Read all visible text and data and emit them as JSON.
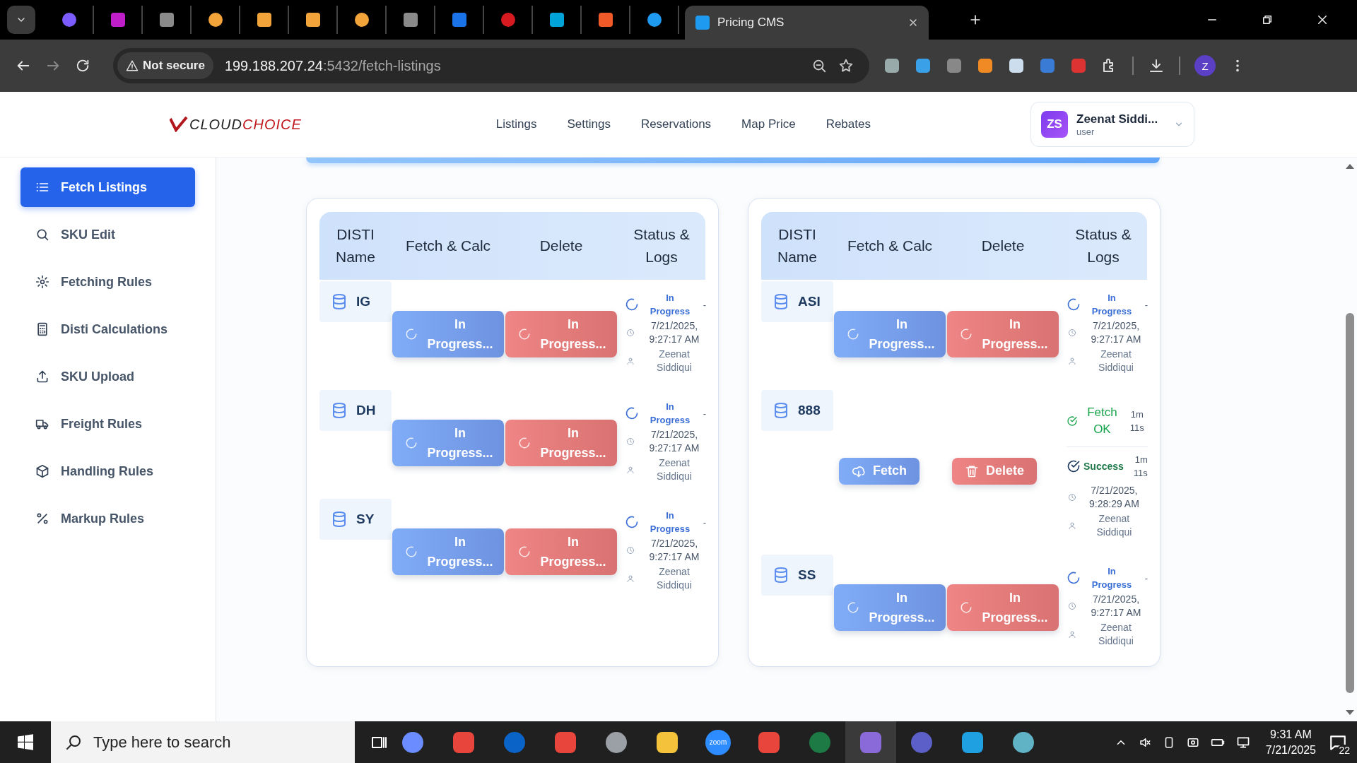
{
  "browser": {
    "tabs": [
      {
        "color": "#7c5cff",
        "selected": false
      },
      {
        "color": "#c01ec8",
        "selected": false
      },
      {
        "color": "#8a8a8a",
        "selected": false
      },
      {
        "color": "#f2a33a",
        "selected": false
      },
      {
        "color": "#f2a33a",
        "selected": false
      },
      {
        "color": "#f2a33a",
        "selected": false
      },
      {
        "color": "#f2a33a",
        "selected": false
      },
      {
        "color": "#8a8a8a",
        "selected": false
      },
      {
        "color": "#1a73e8",
        "selected": false
      },
      {
        "color": "#d71920",
        "selected": false
      },
      {
        "color": "#00a3d9",
        "selected": false
      },
      {
        "color": "#f05a28",
        "selected": false
      },
      {
        "color": "#1e9bf0",
        "selected": false
      },
      {
        "color": "#1e9bf0",
        "title": "Pricing CMS",
        "selected": true
      }
    ],
    "security": "Not secure",
    "url_host": "199.188.207.24",
    "url_path": ":5432/fetch-listings",
    "profile": "Z"
  },
  "app": {
    "logo": {
      "first": "CLOUD",
      "second": "CHOICE"
    },
    "nav": [
      "Listings",
      "Settings",
      "Reservations",
      "Map Price",
      "Rebates"
    ],
    "user": {
      "initials": "ZS",
      "name": "Zeenat Siddi...",
      "role": "user"
    }
  },
  "sidebar": {
    "items": [
      {
        "label": "Fetch Listings",
        "kind": "list",
        "selected": true
      },
      {
        "label": "SKU Edit",
        "kind": "search",
        "selected": false
      },
      {
        "label": "Fetching Rules",
        "kind": "gear",
        "selected": false
      },
      {
        "label": "Disti Calculations",
        "kind": "calculator",
        "selected": false
      },
      {
        "label": "SKU Upload",
        "kind": "upload",
        "selected": false
      },
      {
        "label": "Freight Rules",
        "kind": "truck",
        "selected": false
      },
      {
        "label": "Handling Rules",
        "kind": "box",
        "selected": false
      },
      {
        "label": "Markup Rules",
        "kind": "percent",
        "selected": false
      }
    ]
  },
  "panels": [
    {
      "columns": [
        "DISTI Name",
        "Fetch & Calc",
        "Delete",
        "Status & Logs"
      ],
      "rows": [
        {
          "name": "IG",
          "kind": "running",
          "fetch": "In Progress...",
          "delete": "In Progress...",
          "logs": [
            {
              "kind": "progress",
              "label": "In Progress",
              "duration": "-"
            }
          ],
          "time": "7/21/2025, 9:27:17 AM",
          "user": "Zeenat Siddiqui"
        },
        {
          "name": "DH",
          "kind": "running",
          "fetch": "In Progress...",
          "delete": "In Progress...",
          "logs": [
            {
              "kind": "progress",
              "label": "In Progress",
              "duration": "-"
            }
          ],
          "time": "7/21/2025, 9:27:17 AM",
          "user": "Zeenat Siddiqui"
        },
        {
          "name": "SY",
          "kind": "running",
          "fetch": "In Progress...",
          "delete": "In Progress...",
          "logs": [
            {
              "kind": "progress",
              "label": "In Progress",
              "duration": "-"
            }
          ],
          "time": "7/21/2025, 9:27:17 AM",
          "user": "Zeenat Siddiqui"
        }
      ]
    },
    {
      "columns": [
        "DISTI Name",
        "Fetch & Calc",
        "Delete",
        "Status & Logs"
      ],
      "rows": [
        {
          "name": "ASI",
          "kind": "running",
          "fetch": "In Progress...",
          "delete": "In Progress...",
          "logs": [
            {
              "kind": "progress",
              "label": "In Progress",
              "duration": "-"
            }
          ],
          "time": "7/21/2025, 9:27:17 AM",
          "user": "Zeenat Siddiqui"
        },
        {
          "name": "888",
          "kind": "idle",
          "fetch": "Fetch",
          "delete": "Delete",
          "logs": [
            {
              "kind": "fetch_ok",
              "label": "Fetch OK",
              "duration": "1m 11s"
            },
            {
              "kind": "success",
              "label": "Success",
              "duration": "1m 11s"
            }
          ],
          "time": "7/21/2025, 9:28:29 AM",
          "user": "Zeenat Siddiqui"
        },
        {
          "name": "SS",
          "kind": "running",
          "fetch": "In Progress...",
          "delete": "In Progress...",
          "logs": [
            {
              "kind": "progress",
              "label": "In Progress",
              "duration": "-"
            }
          ],
          "time": "7/21/2025, 9:27:17 AM",
          "user": "Zeenat Siddiqui"
        }
      ]
    }
  ],
  "taskbar": {
    "search_placeholder": "Type here to search",
    "apps": [
      {
        "color": "#6b8cff"
      },
      {
        "color": "#e8453c"
      },
      {
        "color": "#0a64c8"
      },
      {
        "color": "#e8453c"
      },
      {
        "color": "#9aa0a6"
      },
      {
        "color": "#f5c33b"
      },
      {
        "color": "#2d8cff",
        "label": "zoom"
      },
      {
        "color": "#e8453c"
      },
      {
        "color": "#1d7a45"
      },
      {
        "color": "#8a6ad8"
      },
      {
        "color": "#5b5fc7"
      },
      {
        "color": "#1fa0e0"
      },
      {
        "color": "#5fb3c4"
      }
    ],
    "time": "9:31 AM",
    "date": "7/21/2025",
    "notifications": "22"
  }
}
